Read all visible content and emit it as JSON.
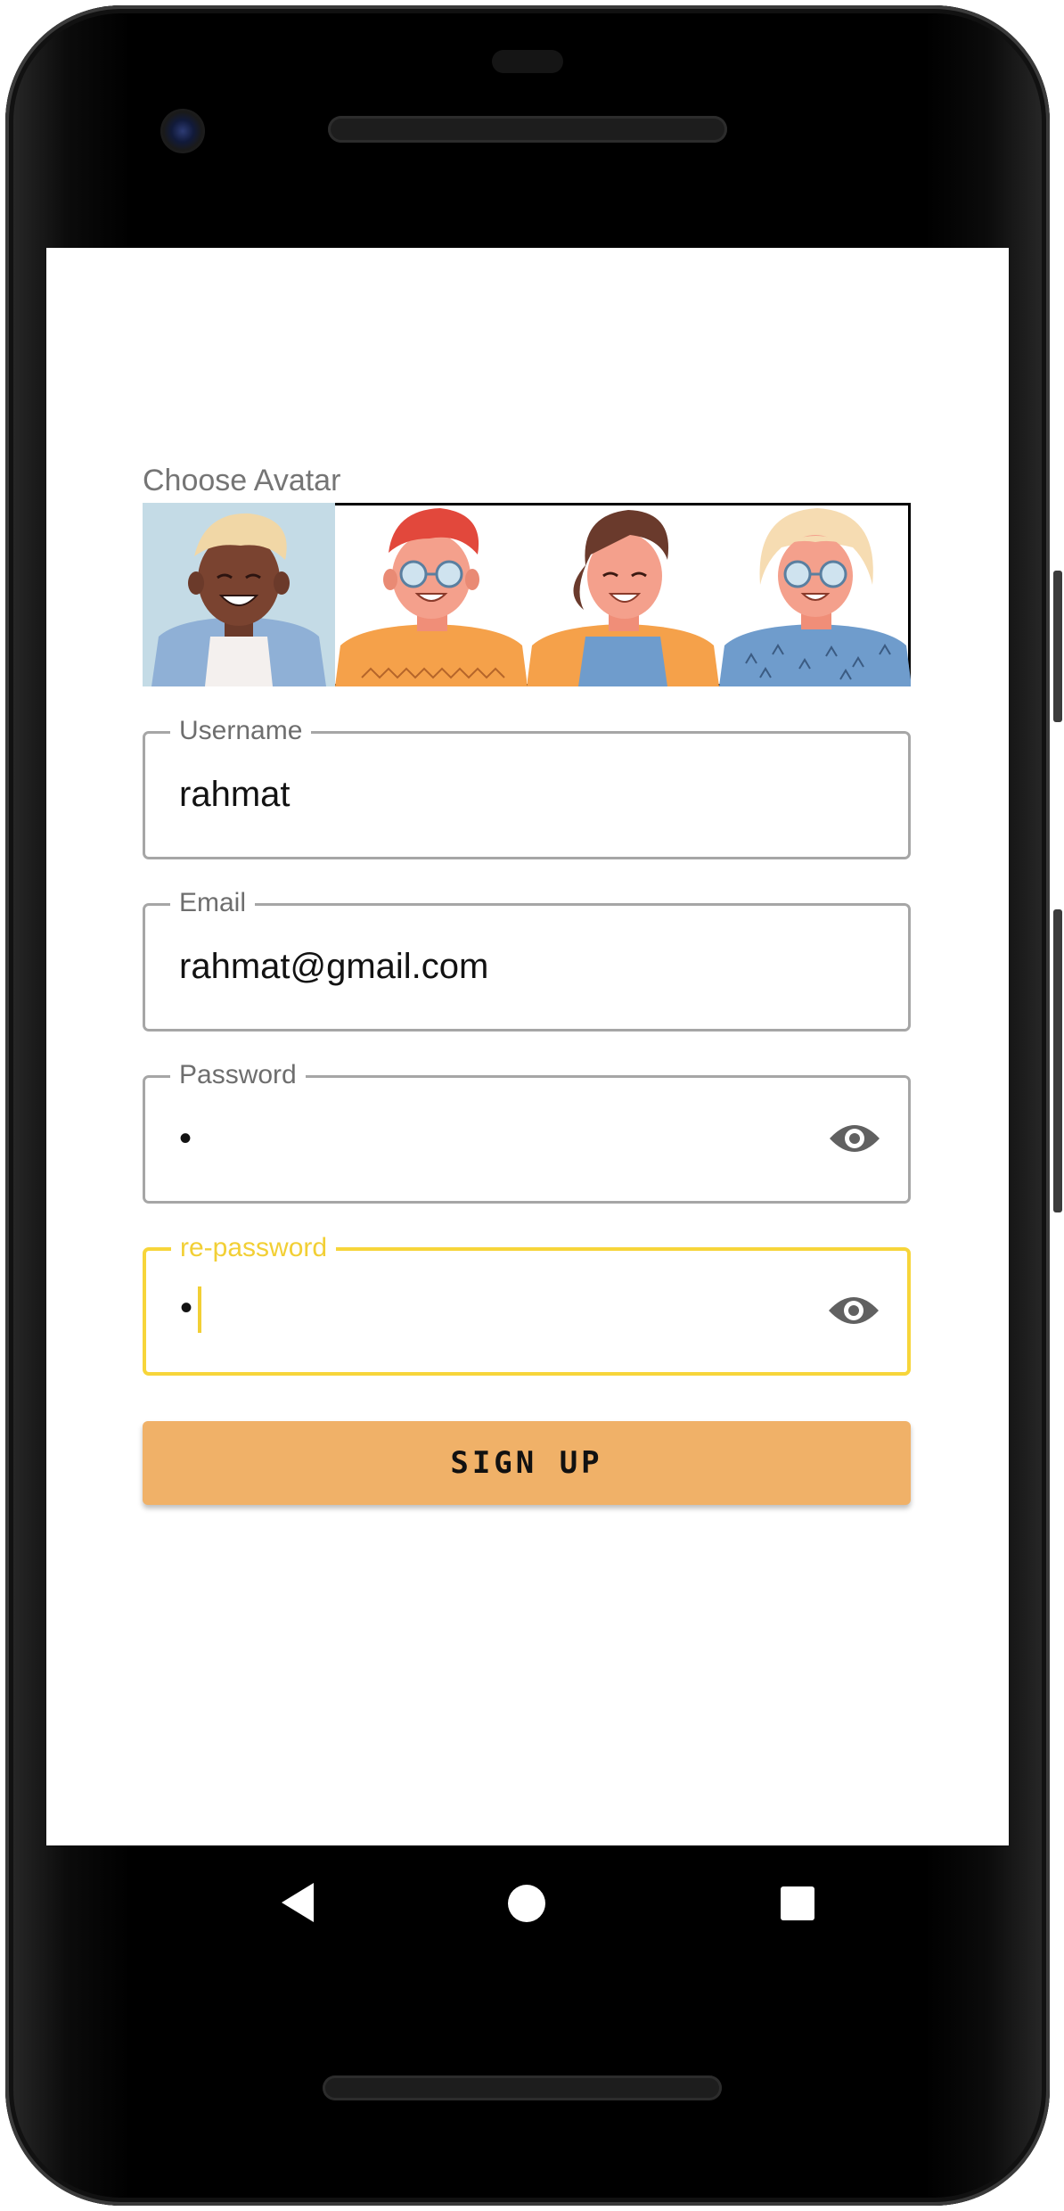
{
  "colors": {
    "accent_focus": "#f7d53a",
    "button_bg": "#f0b168",
    "field_border": "#a6a6a6",
    "label_grey": "#757575"
  },
  "avatar_section": {
    "label": "Choose Avatar",
    "avatars": [
      {
        "name": "avatar-dark-skin-blond-hair",
        "selected": true
      },
      {
        "name": "avatar-red-hair-glasses",
        "selected": false
      },
      {
        "name": "avatar-brown-hair-woman",
        "selected": false
      },
      {
        "name": "avatar-blonde-glasses-woman",
        "selected": false
      }
    ]
  },
  "form": {
    "username": {
      "label": "Username",
      "value": "rahmat"
    },
    "email": {
      "label": "Email",
      "value": "rahmat@gmail.com"
    },
    "password": {
      "label": "Password",
      "value": "•",
      "icon": "eye-icon"
    },
    "repassword": {
      "label": "re-password",
      "value": "•",
      "icon": "eye-icon",
      "focused": true
    }
  },
  "signup_button": {
    "label": "SIGN UP"
  },
  "nav": {
    "back": "back-triangle-icon",
    "home": "home-circle-icon",
    "recents": "recents-square-icon"
  }
}
